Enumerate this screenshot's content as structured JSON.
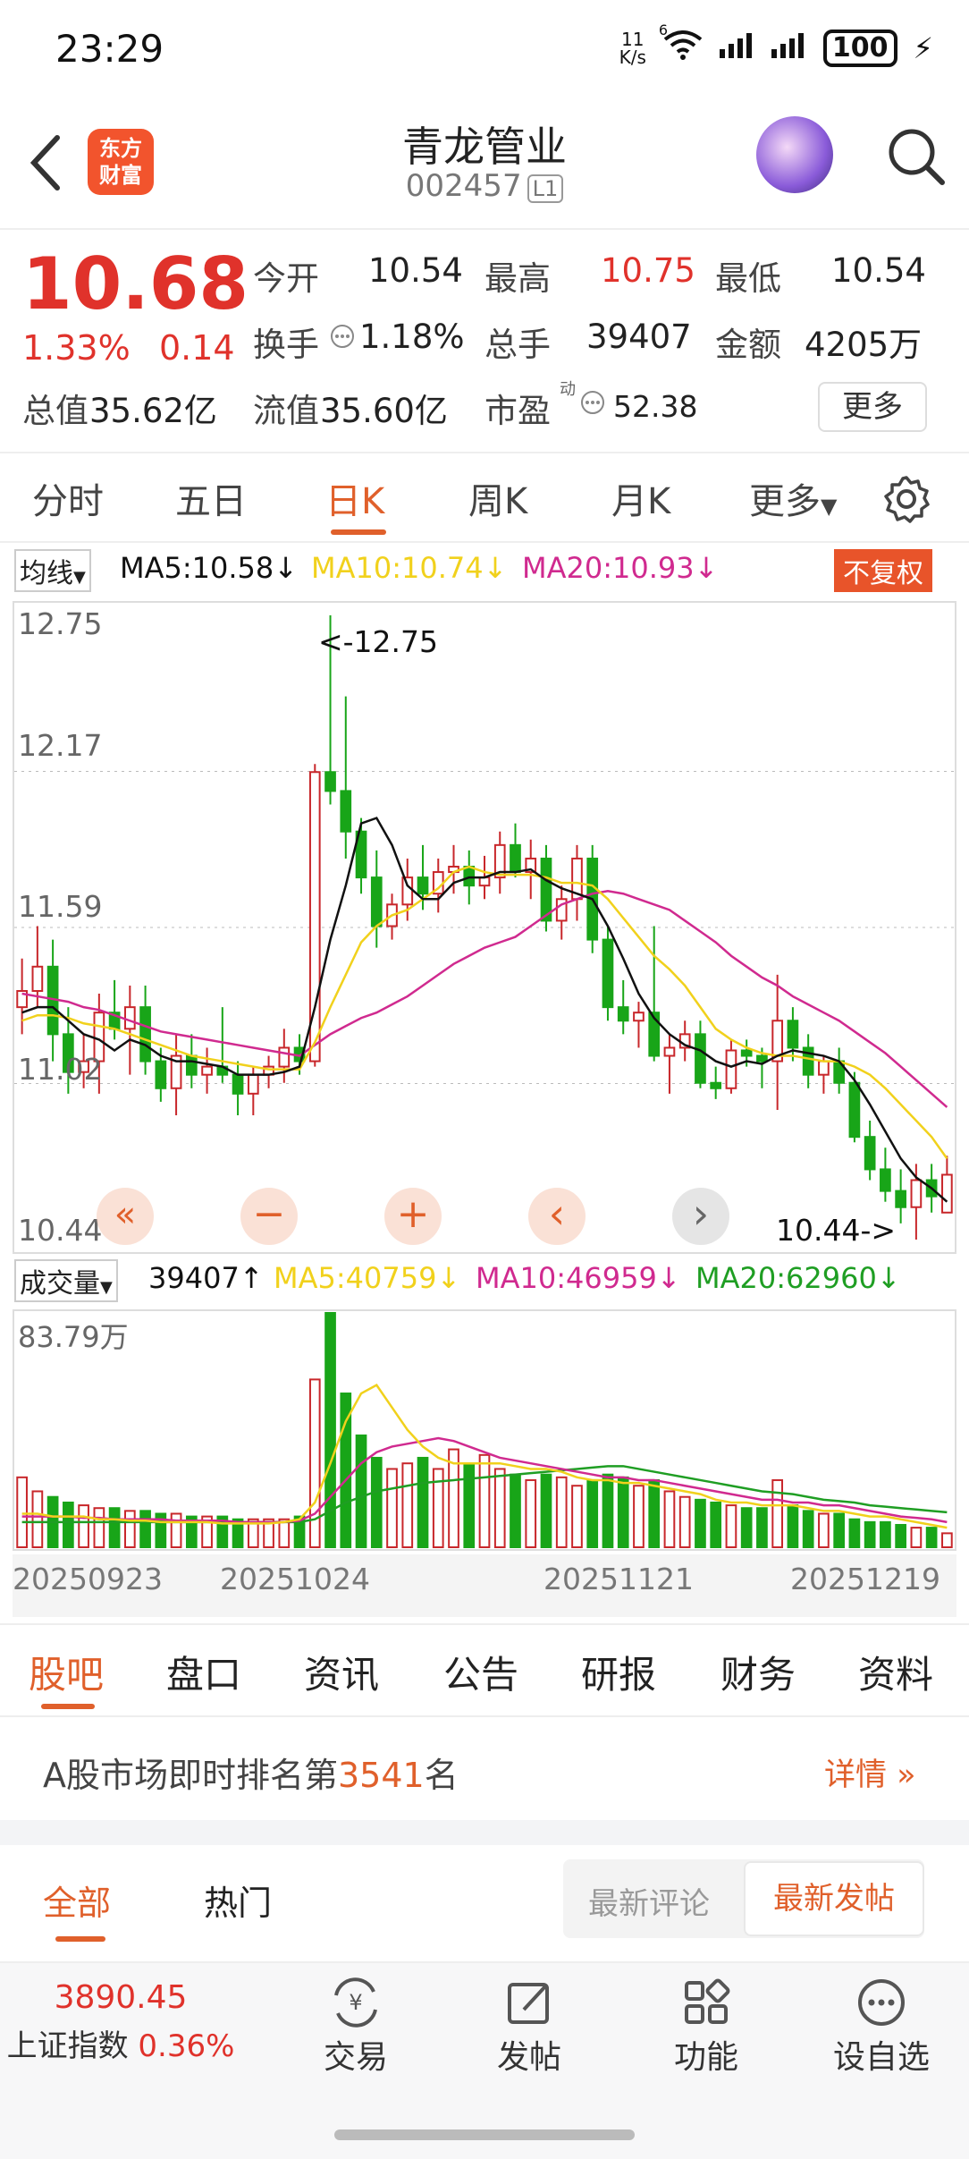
{
  "status_bar": {
    "time": "23:29",
    "net_speed_top": "11",
    "net_speed_unit": "K/s",
    "wifi_label": "6",
    "battery": "100"
  },
  "header": {
    "logo_line1": "东方",
    "logo_line2": "财富",
    "stock_name": "青龙管业",
    "stock_code": "002457",
    "level": "L1"
  },
  "quote": {
    "price": "10.68",
    "change_pct": "1.33%",
    "change_amt": "0.14",
    "open_label": "今开",
    "open": "10.54",
    "high_label": "最高",
    "high": "10.75",
    "low_label": "最低",
    "low": "10.54",
    "turnover_label": "换手",
    "turnover": "1.18%",
    "volume_label": "总手",
    "volume": "39407",
    "amount_label": "金额",
    "amount": "4205万",
    "mktcap_label": "总值",
    "mktcap": "35.62亿",
    "float_label": "流值",
    "float": "35.60亿",
    "pe_label": "市盈",
    "pe_sup": "动",
    "pe": "52.38",
    "more": "更多"
  },
  "period_tabs": [
    "分时",
    "五日",
    "日K",
    "周K",
    "月K",
    "更多"
  ],
  "active_period": 2,
  "ma_legend": {
    "selector": "均线",
    "ma5": "MA5:10.58",
    "ma10": "MA10:10.74",
    "ma20": "MA20:10.93",
    "adjust": "不复权"
  },
  "colors": {
    "up": "#c8272b",
    "down": "#18a518",
    "ma5": "#111111",
    "ma10": "#f1d11c",
    "ma20": "#d02a8f",
    "accent": "#e0602b",
    "vol_ma20": "#1f9e23"
  },
  "price_chart": {
    "y_labels": [
      "12.75",
      "12.17",
      "11.59",
      "11.02",
      "10.44"
    ],
    "max_annotation": "<-12.75",
    "min_annotation": "10.44->"
  },
  "chart_controls": [
    "«",
    "−",
    "+",
    "‹",
    "›"
  ],
  "vol_legend": {
    "selector": "成交量",
    "vol": "39407",
    "ma5": "MA5:40759",
    "ma10": "MA10:46959",
    "ma20": "MA20:62960"
  },
  "vol_chart": {
    "max_label": "83.79万",
    "dates": [
      "20250923",
      "20251024",
      "20251121",
      "20251219"
    ]
  },
  "chart_data": {
    "type": "candlestick",
    "ylim": [
      10.44,
      12.75
    ],
    "ohlc": [
      [
        11.3,
        11.48,
        11.2,
        11.36
      ],
      [
        11.36,
        11.6,
        11.3,
        11.45
      ],
      [
        11.45,
        11.55,
        11.1,
        11.2
      ],
      [
        11.2,
        11.3,
        10.98,
        11.06
      ],
      [
        11.06,
        11.2,
        11.0,
        11.1
      ],
      [
        11.1,
        11.35,
        10.98,
        11.28
      ],
      [
        11.28,
        11.4,
        11.18,
        11.22
      ],
      [
        11.22,
        11.38,
        11.05,
        11.3
      ],
      [
        11.3,
        11.38,
        11.05,
        11.1
      ],
      [
        11.1,
        11.15,
        10.95,
        11.0
      ],
      [
        11.0,
        11.2,
        10.9,
        11.12
      ],
      [
        11.12,
        11.2,
        11.0,
        11.05
      ],
      [
        11.05,
        11.15,
        10.98,
        11.08
      ],
      [
        11.08,
        11.3,
        11.02,
        11.05
      ],
      [
        11.05,
        11.1,
        10.9,
        10.98
      ],
      [
        10.98,
        11.08,
        10.9,
        11.05
      ],
      [
        11.05,
        11.12,
        11.0,
        11.08
      ],
      [
        11.08,
        11.22,
        11.02,
        11.15
      ],
      [
        11.15,
        11.2,
        11.05,
        11.1
      ],
      [
        11.1,
        12.2,
        11.08,
        12.17
      ],
      [
        12.17,
        12.75,
        12.05,
        12.1
      ],
      [
        12.1,
        12.45,
        11.85,
        11.95
      ],
      [
        11.95,
        12.0,
        11.72,
        11.78
      ],
      [
        11.78,
        11.88,
        11.52,
        11.6
      ],
      [
        11.6,
        11.72,
        11.55,
        11.68
      ],
      [
        11.68,
        11.85,
        11.62,
        11.78
      ],
      [
        11.78,
        11.9,
        11.66,
        11.72
      ],
      [
        11.72,
        11.85,
        11.65,
        11.8
      ],
      [
        11.8,
        11.9,
        11.72,
        11.82
      ],
      [
        11.82,
        11.88,
        11.68,
        11.75
      ],
      [
        11.75,
        11.86,
        11.7,
        11.78
      ],
      [
        11.78,
        11.95,
        11.72,
        11.9
      ],
      [
        11.9,
        11.98,
        11.78,
        11.8
      ],
      [
        11.8,
        11.92,
        11.7,
        11.85
      ],
      [
        11.85,
        11.9,
        11.58,
        11.62
      ],
      [
        11.62,
        11.75,
        11.55,
        11.7
      ],
      [
        11.7,
        11.9,
        11.62,
        11.85
      ],
      [
        11.85,
        11.9,
        11.5,
        11.55
      ],
      [
        11.55,
        11.6,
        11.25,
        11.3
      ],
      [
        11.3,
        11.4,
        11.2,
        11.25
      ],
      [
        11.25,
        11.32,
        11.15,
        11.28
      ],
      [
        11.28,
        11.6,
        11.1,
        11.12
      ],
      [
        11.12,
        11.2,
        10.98,
        11.15
      ],
      [
        11.15,
        11.25,
        11.1,
        11.2
      ],
      [
        11.2,
        11.25,
        11.0,
        11.02
      ],
      [
        11.02,
        11.08,
        10.96,
        11.0
      ],
      [
        11.0,
        11.18,
        10.98,
        11.14
      ],
      [
        11.14,
        11.18,
        11.08,
        11.12
      ],
      [
        11.12,
        11.15,
        11.0,
        11.1
      ],
      [
        11.1,
        11.42,
        10.92,
        11.25
      ],
      [
        11.25,
        11.3,
        11.1,
        11.15
      ],
      [
        11.15,
        11.2,
        11.0,
        11.05
      ],
      [
        11.05,
        11.12,
        10.98,
        11.1
      ],
      [
        11.1,
        11.15,
        10.98,
        11.02
      ],
      [
        11.02,
        11.06,
        10.8,
        10.82
      ],
      [
        10.82,
        10.88,
        10.66,
        10.7
      ],
      [
        10.7,
        10.78,
        10.58,
        10.62
      ],
      [
        10.62,
        10.7,
        10.5,
        10.56
      ],
      [
        10.56,
        10.72,
        10.44,
        10.66
      ],
      [
        10.66,
        10.72,
        10.54,
        10.6
      ],
      [
        10.54,
        10.75,
        10.54,
        10.68
      ]
    ],
    "ma5": [
      11.28,
      11.3,
      11.3,
      11.25,
      11.2,
      11.18,
      11.14,
      11.18,
      11.16,
      11.12,
      11.1,
      11.1,
      11.09,
      11.08,
      11.05,
      11.05,
      11.05,
      11.06,
      11.08,
      11.3,
      11.55,
      11.75,
      11.98,
      12.0,
      11.9,
      11.75,
      11.7,
      11.7,
      11.76,
      11.78,
      11.78,
      11.8,
      11.8,
      11.81,
      11.77,
      11.74,
      11.72,
      11.7,
      11.6,
      11.48,
      11.35,
      11.26,
      11.2,
      11.16,
      11.14,
      11.1,
      11.08,
      11.1,
      11.09,
      11.12,
      11.14,
      11.13,
      11.12,
      11.1,
      11.03,
      10.94,
      10.84,
      10.74,
      10.67,
      10.63,
      10.58
    ],
    "ma10": [
      11.25,
      11.27,
      11.27,
      11.26,
      11.24,
      11.23,
      11.22,
      11.2,
      11.18,
      11.16,
      11.14,
      11.12,
      11.11,
      11.1,
      11.09,
      11.08,
      11.07,
      11.07,
      11.07,
      11.17,
      11.3,
      11.42,
      11.54,
      11.6,
      11.64,
      11.66,
      11.7,
      11.74,
      11.8,
      11.82,
      11.8,
      11.79,
      11.79,
      11.79,
      11.78,
      11.76,
      11.76,
      11.75,
      11.7,
      11.63,
      11.56,
      11.49,
      11.44,
      11.38,
      11.3,
      11.22,
      11.18,
      11.15,
      11.13,
      11.12,
      11.12,
      11.11,
      11.1,
      11.1,
      11.08,
      11.05,
      11.0,
      10.94,
      10.88,
      10.82,
      10.74
    ],
    "ma20": [
      11.35,
      11.34,
      11.33,
      11.32,
      11.3,
      11.29,
      11.27,
      11.25,
      11.23,
      11.21,
      11.2,
      11.19,
      11.18,
      11.17,
      11.16,
      11.15,
      11.14,
      11.13,
      11.12,
      11.16,
      11.2,
      11.23,
      11.26,
      11.28,
      11.31,
      11.34,
      11.38,
      11.42,
      11.46,
      11.49,
      11.52,
      11.54,
      11.56,
      11.6,
      11.64,
      11.68,
      11.7,
      11.72,
      11.73,
      11.72,
      11.7,
      11.68,
      11.66,
      11.62,
      11.58,
      11.54,
      11.49,
      11.45,
      11.41,
      11.38,
      11.34,
      11.31,
      11.28,
      11.25,
      11.21,
      11.17,
      11.13,
      11.08,
      11.03,
      10.98,
      10.93
    ],
    "volume": [
      25,
      20,
      18,
      16,
      15,
      14,
      14,
      13,
      13,
      12,
      12,
      11,
      11,
      11,
      10,
      10,
      10,
      10,
      11,
      60,
      83.79,
      55,
      40,
      32,
      28,
      30,
      32,
      28,
      35,
      30,
      33,
      28,
      26,
      24,
      26,
      25,
      22,
      24,
      26,
      25,
      22,
      24,
      20,
      18,
      17,
      16,
      15,
      14,
      14,
      24,
      15,
      13,
      12,
      12,
      10,
      9,
      9,
      8,
      7,
      7,
      5
    ],
    "vol_ma5": [
      12,
      12,
      11,
      11,
      11,
      10,
      10,
      9.5,
      9.5,
      9,
      9,
      9,
      9,
      8.5,
      8.5,
      8.5,
      8.5,
      9,
      10,
      16,
      30,
      45,
      55,
      58,
      50,
      42,
      36,
      32,
      30,
      30,
      30,
      30,
      29,
      28,
      28,
      27,
      25,
      24,
      24,
      23,
      23,
      22,
      21,
      20,
      19,
      17,
      16,
      16,
      15,
      15,
      15,
      14,
      13,
      13,
      12,
      11,
      11,
      10,
      9,
      8,
      7
    ],
    "vol_ma10": [
      11,
      11,
      11,
      11,
      10.5,
      10.5,
      10,
      10,
      10,
      10,
      9.5,
      9.5,
      9.5,
      9.5,
      9,
      9,
      9,
      9,
      9.5,
      12,
      18,
      24,
      30,
      34,
      36,
      37,
      38,
      39,
      38,
      36,
      34,
      32,
      31,
      30,
      29,
      28,
      27,
      26,
      25,
      25,
      24,
      24,
      23,
      22,
      21,
      20,
      19,
      18,
      17,
      17,
      16,
      16,
      15,
      15,
      14,
      13,
      12,
      11,
      10.5,
      10,
      9
    ],
    "vol_ma20": [
      9,
      9,
      9,
      9,
      9,
      9,
      9,
      9,
      9,
      9,
      9,
      9,
      9,
      9,
      9,
      9,
      9,
      9,
      9,
      10,
      13,
      16,
      18,
      20,
      21,
      22,
      23,
      23.5,
      24,
      24.5,
      25,
      25.5,
      26,
      26.5,
      27,
      27.5,
      28,
      28.5,
      29,
      29,
      28,
      27,
      26,
      25,
      24,
      23,
      22,
      21,
      20,
      19.5,
      19,
      18,
      17,
      16.5,
      16,
      15,
      14.5,
      14,
      13.5,
      13,
      12.5
    ],
    "vol_max": 83.79
  },
  "content_tabs": [
    "股吧",
    "盘口",
    "资讯",
    "公告",
    "研报",
    "财务",
    "资料"
  ],
  "rank": {
    "prefix": "A股市场即时排名第",
    "number": "3541",
    "suffix": "名",
    "detail": "详情"
  },
  "filters": {
    "all": "全部",
    "hot": "热门",
    "latest_comment": "最新评论",
    "latest_post": "最新发帖"
  },
  "bottom_nav": {
    "index_value": "3890.45",
    "index_name": "上证指数",
    "index_change": "0.36%",
    "trade": "交易",
    "post": "发帖",
    "func": "功能",
    "watch": "设自选"
  }
}
